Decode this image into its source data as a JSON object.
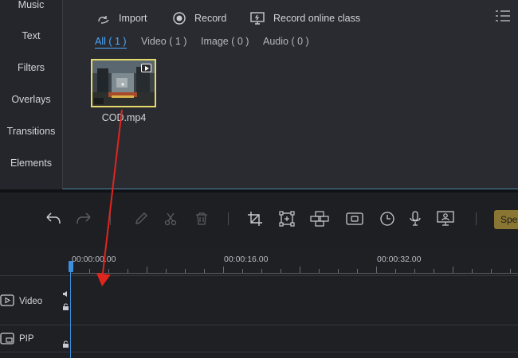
{
  "sidebar": {
    "items": [
      {
        "label": "Music"
      },
      {
        "label": "Text"
      },
      {
        "label": "Filters"
      },
      {
        "label": "Overlays"
      },
      {
        "label": "Transitions"
      },
      {
        "label": "Elements"
      }
    ]
  },
  "media_toolbar": {
    "import_label": "Import",
    "record_label": "Record",
    "record_class_label": "Record online class"
  },
  "media_filters": {
    "tabs": [
      {
        "label": "All ( 1 )",
        "active": true
      },
      {
        "label": "Video ( 1 )",
        "active": false
      },
      {
        "label": "Image ( 0 )",
        "active": false
      },
      {
        "label": "Audio ( 0 )",
        "active": false
      }
    ]
  },
  "media": {
    "files": [
      {
        "name": "COD.mp4",
        "selected": true
      }
    ]
  },
  "edit_toolbar": {
    "speed_label": "Spe"
  },
  "timeline": {
    "time_labels": [
      "00:00:00.00",
      "00:00:16.00",
      "00:00:32.00"
    ],
    "tracks": [
      {
        "label": "Video"
      },
      {
        "label": "PIP"
      }
    ]
  },
  "colors": {
    "accent": "#4aa8ff",
    "selection": "#e6d86a",
    "annotation": "#e0251f",
    "playhead": "#3d8fe0",
    "speed_button": "#8a7633"
  }
}
